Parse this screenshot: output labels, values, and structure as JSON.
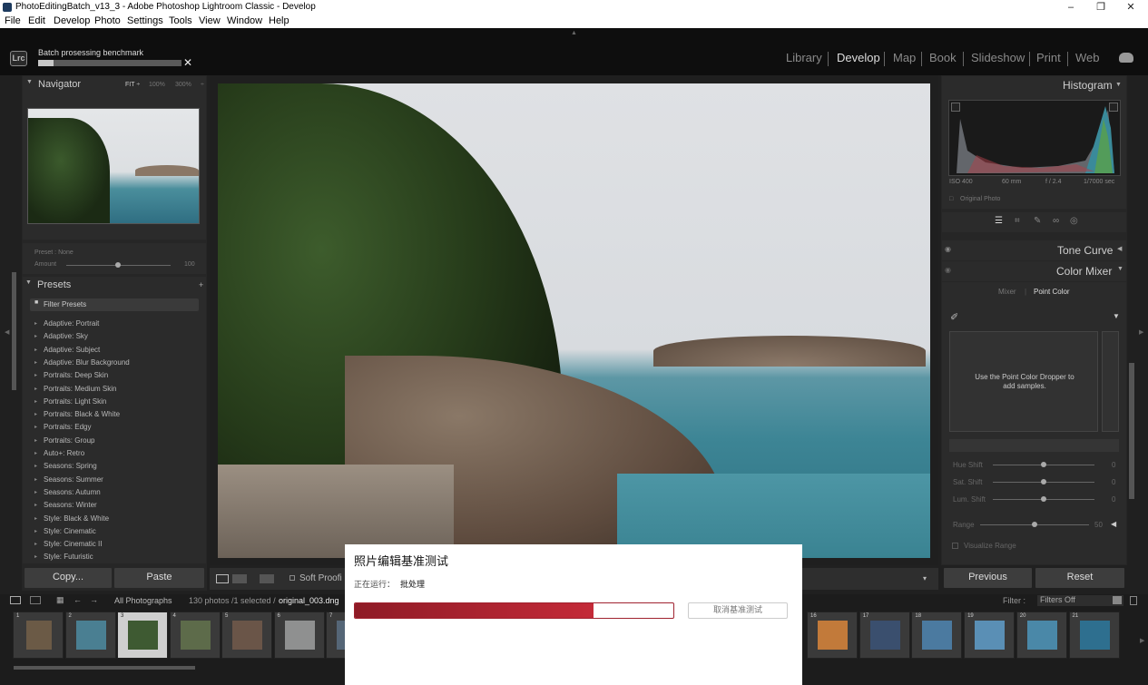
{
  "window": {
    "title": "PhotoEditingBatch_v13_3 - Adobe Photoshop Lightroom Classic - Develop",
    "minimize": "–",
    "maximize": "❐",
    "close": "✕"
  },
  "menu": [
    "File",
    "Edit",
    "Develop",
    "Photo",
    "Settings",
    "Tools",
    "View",
    "Window",
    "Help"
  ],
  "batch": {
    "logo": "Lrc",
    "label": "Batch prosessing benchmark",
    "progress": 0.11,
    "close": "✕"
  },
  "modules": [
    "Library",
    "Develop",
    "Map",
    "Book",
    "Slideshow",
    "Print",
    "Web"
  ],
  "active_module": "Develop",
  "navigator": {
    "title": "Navigator",
    "zoom_fit": "FIT ÷",
    "zoom_100": "100%",
    "zoom_300": "300%"
  },
  "preset_box": {
    "preset_label": "Preset : None",
    "amount_label": "Amount",
    "amount_value": "100"
  },
  "presets": {
    "title": "Presets",
    "filter": "Filter Presets",
    "items": [
      "Adaptive: Portrait",
      "Adaptive: Sky",
      "Adaptive: Subject",
      "Adaptive: Blur Background",
      "Portraits: Deep Skin",
      "Portraits: Medium Skin",
      "Portraits: Light Skin",
      "Portraits: Black & White",
      "Portraits: Edgy",
      "Portraits: Group",
      "Auto+: Retro",
      "Seasons: Spring",
      "Seasons: Summer",
      "Seasons: Autumn",
      "Seasons: Winter",
      "Style: Black & White",
      "Style: Cinematic",
      "Style: Cinematic II",
      "Style: Futuristic"
    ]
  },
  "left_buttons": {
    "copy": "Copy...",
    "paste": "Paste"
  },
  "toolbar": {
    "soft_proofing": "Soft Proofi"
  },
  "histogram": {
    "title": "Histogram",
    "iso": "ISO 400",
    "focal": "60 mm",
    "aperture": "f / 2.4",
    "shutter": "1/7000 sec",
    "original": "Original Photo"
  },
  "tone_curve": {
    "title": "Tone Curve"
  },
  "color_mixer": {
    "title": "Color Mixer",
    "tab_mixer": "Mixer",
    "tab_point": "Point Color",
    "hint": "Use the Point Color Dropper to add samples.",
    "sliders": [
      {
        "label": "Hue Shift",
        "value": "0"
      },
      {
        "label": "Sat. Shift",
        "value": "0"
      },
      {
        "label": "Lum. Shift",
        "value": "0"
      },
      {
        "label": "Range",
        "value": "50"
      }
    ],
    "visualize": "Visualize Range"
  },
  "right_buttons": {
    "previous": "Previous",
    "reset": "Reset"
  },
  "filmstrip_bar": {
    "source": "All Photographs",
    "count": "130 photos /1 selected /",
    "file": "original_003.dng",
    "filter_label": "Filter :",
    "filter_value": "Filters Off"
  },
  "thumbs_left": [
    "1",
    "2",
    "3",
    "4",
    "5",
    "6",
    "7"
  ],
  "thumbs_right": [
    "16",
    "17",
    "18",
    "19",
    "20",
    "21"
  ],
  "dialog": {
    "title": "照片编辑基准测试",
    "status_label": "正在运行：",
    "status_value": "批处理",
    "progress": 0.75,
    "cancel": "取消基准测试"
  },
  "colors": {
    "accent_red": "#a0222f",
    "panel": "#2b2b2b",
    "bg": "#202020"
  }
}
